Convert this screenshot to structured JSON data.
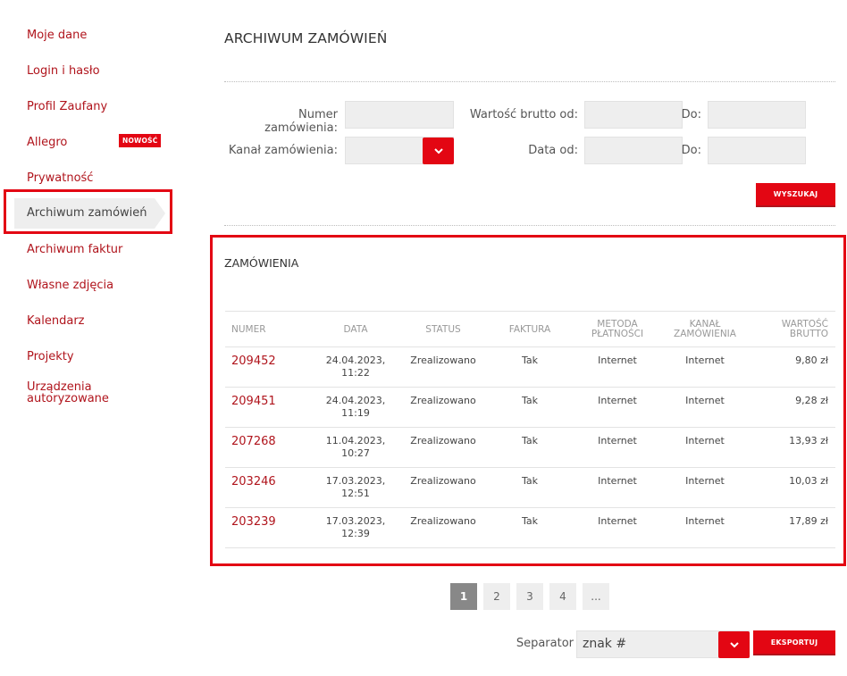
{
  "sidebar": {
    "items": [
      {
        "label": "Moje dane"
      },
      {
        "label": "Login i hasło"
      },
      {
        "label": "Profil Zaufany"
      },
      {
        "label": "Allegro",
        "badge": "NOWOŚĆ"
      },
      {
        "label": "Prywatność"
      },
      {
        "label": "Archiwum zamówień"
      },
      {
        "label": "Archiwum faktur"
      },
      {
        "label": "Własne zdjęcia"
      },
      {
        "label": "Kalendarz"
      },
      {
        "label": "Projekty"
      },
      {
        "label": "Urządzenia autoryzowane"
      }
    ]
  },
  "page": {
    "title": "ARCHIWUM ZAMÓWIEŃ"
  },
  "search": {
    "order_number_label": "Numer zamówienia:",
    "order_number_value": "",
    "channel_label": "Kanał zamówienia:",
    "channel_value": "",
    "gross_from_label": "Wartość brutto od:",
    "gross_from_value": "",
    "gross_to_label": "Do:",
    "gross_to_value": "",
    "date_from_label": "Data od:",
    "date_from_value": "",
    "date_to_label": "Do:",
    "date_to_value": "",
    "search_button": "WYSZUKAJ"
  },
  "orders": {
    "title": "ZAMÓWIENIA",
    "columns": {
      "number": "NUMER",
      "date": "DATA",
      "status": "STATUS",
      "invoice": "FAKTURA",
      "payment_1": "METODA",
      "payment_2": "PŁATNOŚCI",
      "channel_1": "KANAŁ",
      "channel_2": "ZAMÓWIENIA",
      "gross_1": "WARTOŚĆ",
      "gross_2": "BRUTTO"
    },
    "rows": [
      {
        "number": "209452",
        "date": "24.04.2023,",
        "time": "11:22",
        "status": "Zrealizowano",
        "invoice": "Tak",
        "payment": "Internet",
        "channel": "Internet",
        "gross": "9,80 zł"
      },
      {
        "number": "209451",
        "date": "24.04.2023,",
        "time": "11:19",
        "status": "Zrealizowano",
        "invoice": "Tak",
        "payment": "Internet",
        "channel": "Internet",
        "gross": "9,28 zł"
      },
      {
        "number": "207268",
        "date": "11.04.2023,",
        "time": "10:27",
        "status": "Zrealizowano",
        "invoice": "Tak",
        "payment": "Internet",
        "channel": "Internet",
        "gross": "13,93 zł"
      },
      {
        "number": "203246",
        "date": "17.03.2023,",
        "time": "12:51",
        "status": "Zrealizowano",
        "invoice": "Tak",
        "payment": "Internet",
        "channel": "Internet",
        "gross": "10,03 zł"
      },
      {
        "number": "203239",
        "date": "17.03.2023,",
        "time": "12:39",
        "status": "Zrealizowano",
        "invoice": "Tak",
        "payment": "Internet",
        "channel": "Internet",
        "gross": "17,89 zł"
      }
    ]
  },
  "pagination": {
    "pages": [
      "1",
      "2",
      "3",
      "4",
      "..."
    ],
    "current": "1"
  },
  "export": {
    "separator_label": "Separator",
    "separator_value": "znak #",
    "export_button": "EKSPORTUJ"
  },
  "colors": {
    "accent": "#e30613",
    "link": "#b0141c",
    "field_bg": "#eeeeee"
  }
}
